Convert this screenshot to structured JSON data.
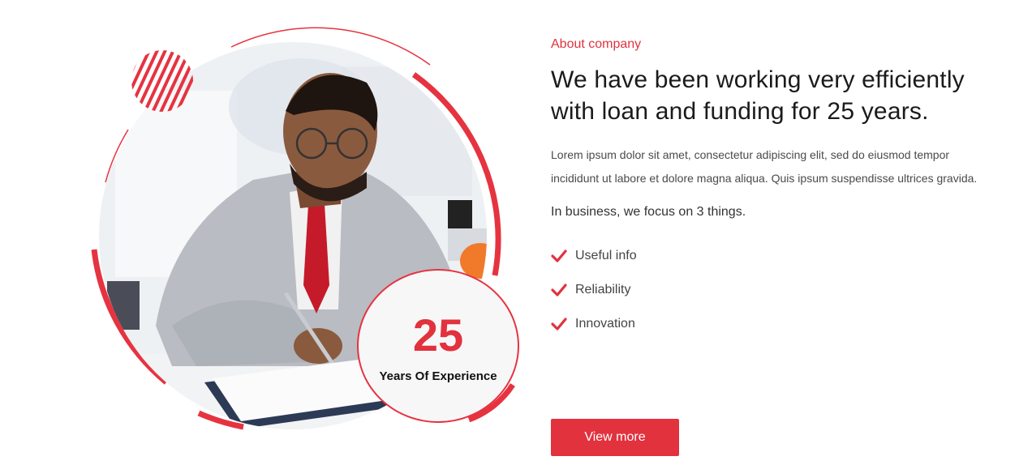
{
  "colors": {
    "accent": "#e1323e",
    "text": "#1b1b1b",
    "muted": "#4a4a4a"
  },
  "visual": {
    "photo_alt": "Businessman in a grey suit writing on a clipboard",
    "badge_number": "25",
    "badge_label": "Years Of Experience"
  },
  "about": {
    "eyebrow": "About company",
    "heading": "We have been working very efficiently with loan and funding for 25 years.",
    "paragraph": "Lorem ipsum dolor sit amet, consectetur adipiscing elit, sed do eiusmod tempor incididunt ut labore et dolore magna aliqua. Quis ipsum suspendisse ultrices gravida.",
    "focus_text": "In business, we focus on 3 things.",
    "checklist": [
      {
        "label": "Useful info",
        "icon": "check-icon"
      },
      {
        "label": "Reliability",
        "icon": "check-icon"
      },
      {
        "label": "Innovation",
        "icon": "check-icon"
      }
    ],
    "button_label": "View more"
  }
}
